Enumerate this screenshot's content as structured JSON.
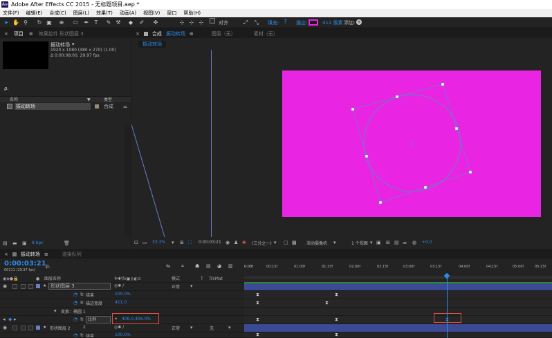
{
  "window": {
    "title": "Adobe After Effects CC 2015 - 无标题项目.aep *",
    "logo": "Ae"
  },
  "menu": [
    "文件(F)",
    "编辑(E)",
    "合成(C)",
    "图层(L)",
    "效果(T)",
    "动画(A)",
    "视图(V)",
    "窗口",
    "帮助(H)"
  ],
  "toolbar": {
    "align_label": "对齐",
    "fill_label": "填充:",
    "stroke_label": "描边:",
    "stroke_width": "411 像素",
    "add_label": "添加:",
    "tool_icons": [
      "arrow-icon",
      "hand-icon",
      "zoom-icon",
      "rotate-icon",
      "camera-icon",
      "pan-behind-icon",
      "ellipse-icon",
      "pen-icon",
      "text-icon",
      "brush-icon",
      "clone-stamp-icon",
      "eraser-icon",
      "roto-brush-icon",
      "puppet-icon"
    ]
  },
  "project_panel": {
    "tab_project": "项目",
    "tab_effects": "效果控件 形状图层 3",
    "comp_name": "振动转场",
    "comp_dims": "1920 x 1080 (480 x 270) (1.00)",
    "comp_duration": "Δ 0:00:08:00, 29.97 fps",
    "search_placeholder": "ρ.",
    "col_name": "名称",
    "col_type": "类型",
    "item_name": "振动转场",
    "item_type": "合成",
    "bpc": "8 bpc"
  },
  "comp_panel": {
    "tab_label": "合成",
    "comp_tab_name": "振动转场",
    "tab_layer": "图层（无）",
    "tab_footage": "素材（无）",
    "breadcrumb": "振动转场",
    "zoom": "33.3%",
    "timecode": "0:00:03:21",
    "resolution": "(三分之一)",
    "camera": "活动摄像机",
    "views": "1 个视图",
    "exposure": "+0.0",
    "bg_color": "#e925e3"
  },
  "timeline": {
    "tab_comp": "振动转场",
    "tab_render": "渲染队列",
    "timecode": "0:00:03:21",
    "frame_info": "00111 (29.97 fps)",
    "search_placeholder": "ρ.",
    "col_layer_name": "图层名称",
    "col_mode": "模式",
    "col_t": "T",
    "col_trkmat": "TrkMat",
    "ruler": [
      "0:00f",
      "00:15f",
      "01:00f",
      "01:15f",
      "02:00f",
      "02:15f",
      "03:00f",
      "03:15f",
      "04:00f",
      "04:15f",
      "05:00f",
      "05:15f"
    ],
    "layers": [
      {
        "num": "3",
        "name": "形状图层 3",
        "mode": "正常"
      },
      {
        "prop": "结束",
        "value": "100.0%"
      },
      {
        "prop": "描边宽度",
        "value": "411.0"
      },
      {
        "group": "变换：椭圆 1"
      },
      {
        "prop": "比例",
        "value": "406.0,406.0%"
      },
      {
        "num": "2",
        "name": "形状图层 2",
        "mode": "正常",
        "trkmat": "无"
      },
      {
        "prop": "结束",
        "value": "100.0%"
      }
    ]
  }
}
